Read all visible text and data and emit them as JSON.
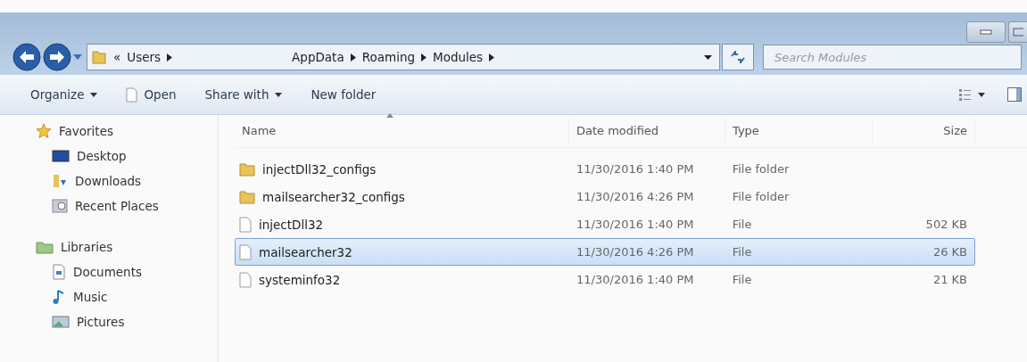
{
  "address_bar": {
    "overflow": "«",
    "crumbs": [
      "Users",
      "AppData",
      "Roaming",
      "Modules"
    ]
  },
  "search": {
    "placeholder": "Search Modules"
  },
  "toolbar": [
    "Organize",
    "Open",
    "Share with",
    "New folder"
  ],
  "sidebar": [
    {
      "label": "Favorites",
      "kind": "favorites",
      "children": [
        {
          "label": "Desktop",
          "kind": "desktop"
        },
        {
          "label": "Downloads",
          "kind": "downloads"
        },
        {
          "label": "Recent Places",
          "kind": "recent"
        }
      ]
    },
    {
      "label": "Libraries",
      "kind": "libraries",
      "children": [
        {
          "label": "Documents",
          "kind": "documents"
        },
        {
          "label": "Music",
          "kind": "music"
        },
        {
          "label": "Pictures",
          "kind": "pictures"
        }
      ]
    }
  ],
  "table": {
    "columns": [
      "Name",
      "Date modified",
      "Type",
      "Size"
    ],
    "rows": [
      {
        "name": "injectDll32_configs",
        "kind": "folder",
        "date": "11/30/2016 1:40 PM",
        "type": "File folder",
        "selected": false
      },
      {
        "name": "mailsearcher32_configs",
        "kind": "folder",
        "date": "11/30/2016 4:26 PM",
        "type": "File folder",
        "selected": false
      },
      {
        "name": "injectDll32",
        "kind": "file",
        "date": "11/30/2016 1:40 PM",
        "type": "File",
        "size": "502 KB",
        "selected": false
      },
      {
        "name": "mailsearcher32",
        "kind": "file",
        "date": "11/30/2016 4:26 PM",
        "type": "File",
        "size": "26 KB",
        "selected": true
      },
      {
        "name": "systeminfo32",
        "kind": "file",
        "date": "11/30/2016 1:40 PM",
        "type": "File",
        "size": "21 KB",
        "selected": false
      }
    ]
  }
}
